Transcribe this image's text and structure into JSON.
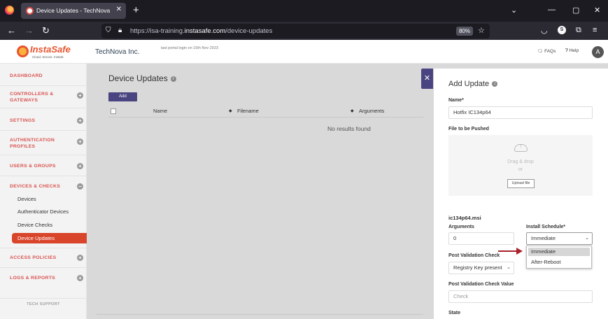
{
  "browser": {
    "tab_title": "Device Updates - TechNova Inc",
    "url_prefix": "https://isa-training.",
    "url_domain": "instasafe.com",
    "url_path": "/device-updates",
    "zoom": "80%",
    "account_initial": "S"
  },
  "header": {
    "logo_text": "InstaSafe",
    "logo_tagline": "Cloud. Secure. Instant.",
    "org_name": "TechNova Inc.",
    "last_login": "last portal login on 15th Nov 2023",
    "faq_label": "FAQs",
    "help_label": "Help",
    "avatar_initial": "A"
  },
  "sidebar": {
    "dashboard": "DASHBOARD",
    "controllers": "CONTROLLERS & GATEWAYS",
    "settings": "SETTINGS",
    "authentication": "AUTHENTICATION PROFILES",
    "users": "USERS & GROUPS",
    "devices": "DEVICES & CHECKS",
    "sub_devices": "Devices",
    "sub_authenticator": "Authenticator Devices",
    "sub_checks": "Device Checks",
    "sub_updates": "Device Updates",
    "access": "ACCESS POLICIES",
    "logs": "LOGS & REPORTS",
    "tech_support": "TECH SUPPORT"
  },
  "main": {
    "title": "Device Updates",
    "add_label": "Add",
    "columns": [
      "Name",
      "Filename",
      "Arguments"
    ],
    "empty_text": "No results found"
  },
  "drawer": {
    "title": "Add Update",
    "name_label": "Name*",
    "name_value": "Hotfix IC134p64",
    "file_label": "File to be Pushed",
    "drag_text": "Drag & drop",
    "or_text": "or",
    "upload_label": "Upload file",
    "file_name": "ic134p64.msi",
    "arguments_label": "Arguments",
    "arguments_value": "0",
    "schedule_label": "Install Schedule*",
    "schedule_value": "Immediate",
    "schedule_options": [
      "Immediate",
      "After-Reboot"
    ],
    "pvc_label": "Post Validation Check",
    "pvc_value": "Registry Key present",
    "pvcv_label": "Post Validation Check Value",
    "pvcv_placeholder": "Check",
    "state_label": "State"
  },
  "colors": {
    "accent_red": "#d9452b",
    "brand_purple": "#4a4580",
    "annotation_arrow": "#a8222a"
  }
}
